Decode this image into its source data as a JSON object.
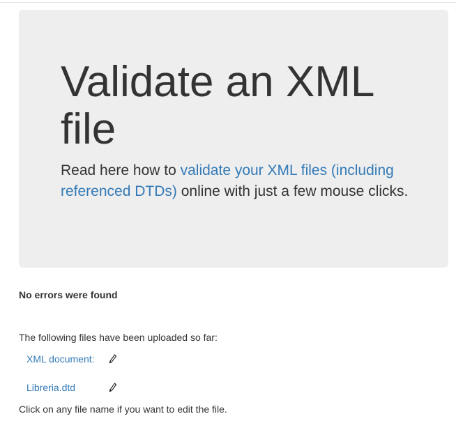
{
  "jumbotron": {
    "title": "Validate an XML file",
    "lead_before": "Read here how to ",
    "lead_link": "validate your XML files (including referenced DTDs)",
    "lead_after": " online with just a few mouse clicks."
  },
  "status": {
    "message": "No errors were found"
  },
  "files": {
    "intro": "The following files have been uploaded so far:",
    "items": [
      {
        "label": "XML document:",
        "edit_icon": "pencil-icon"
      },
      {
        "label": "Libreria.dtd",
        "edit_icon": "pencil-icon"
      }
    ],
    "footer_note": "Click on any file name if you want to edit the file."
  },
  "colors": {
    "jumbotron_bg": "#eeeeee",
    "link": "#337ab7",
    "text": "#333333"
  }
}
